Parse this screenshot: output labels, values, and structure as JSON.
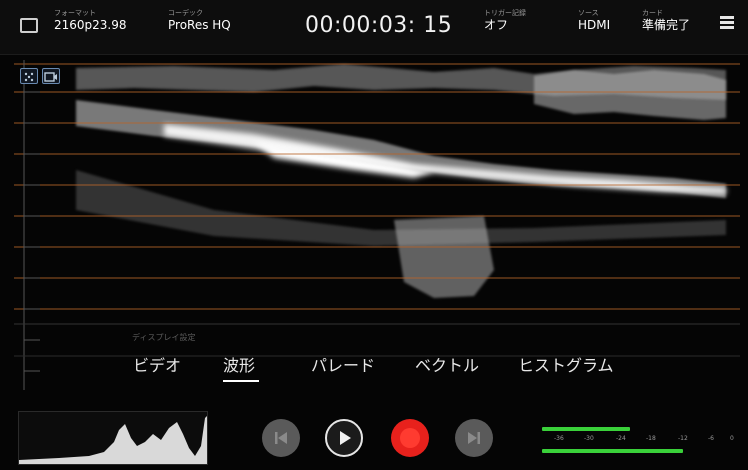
{
  "top_bar": {
    "format_label": "フォーマット",
    "format_value": "2160p23.98",
    "codec_label": "コーデック",
    "codec_value": "ProRes HQ",
    "timecode": "00:00:03: 15",
    "trigger_label": "トリガー記録",
    "trigger_value": "オフ",
    "source_label": "ソース",
    "source_value": "HDMI",
    "card_label": "カード",
    "card_value": "準備完了"
  },
  "scope": {
    "display_settings_label": "ディスプレイ設定",
    "grid_color": "#b7652a",
    "trace_color": "#ffffff"
  },
  "tabs": [
    {
      "label": "ビデオ"
    },
    {
      "label": "波形"
    },
    {
      "label": "パレード"
    },
    {
      "label": "ベクトル"
    },
    {
      "label": "ヒストグラム"
    }
  ],
  "active_tab": "波形",
  "controls": {
    "prev_icon": "skip-back-icon",
    "play_icon": "play-icon",
    "record_icon": "record-icon",
    "next_icon": "skip-forward-icon",
    "record_color": "#e8211c"
  },
  "audio_meters": {
    "ticks": [
      "-36",
      "-30",
      "-24",
      "-18",
      "-12",
      "-6",
      "0"
    ],
    "channel_1_level": 0.45,
    "channel_2_level": 0.72,
    "meter_color": "#3ad13a"
  }
}
